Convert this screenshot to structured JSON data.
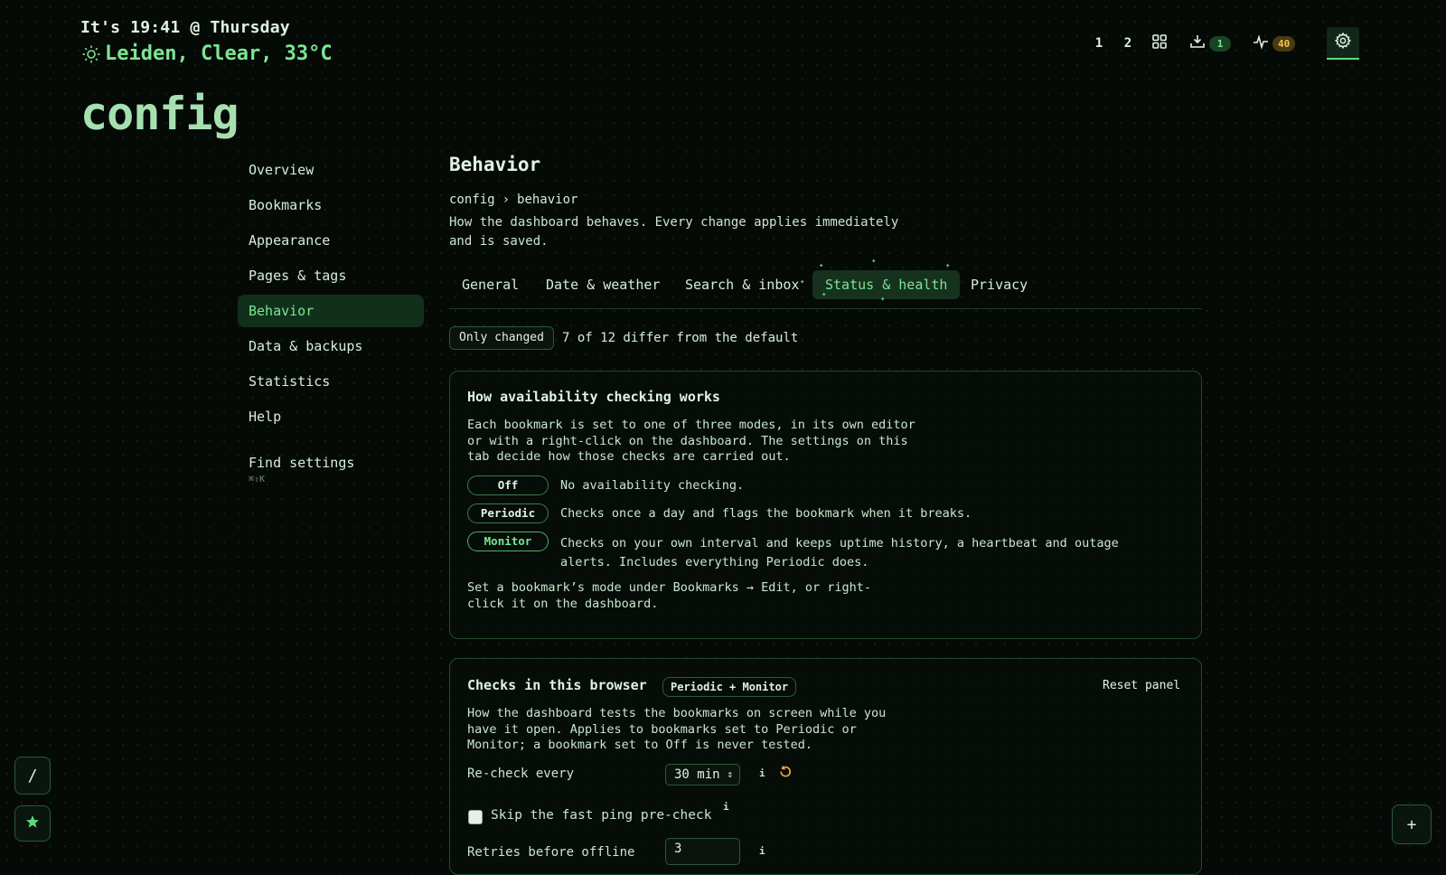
{
  "header": {
    "clock": "It's 19:41 @ Thursday",
    "weather_icon": "sun-icon",
    "weather": "Leiden, Clear, 33°C",
    "page_title": "config"
  },
  "topnav": {
    "page1": "1",
    "page2": "2",
    "grid_icon": "grid-icon",
    "inbox_icon": "inbox-tray-icon",
    "inbox_count": "1",
    "health_icon": "heartbeat-icon",
    "health_count": "40",
    "settings_icon": "gear-icon"
  },
  "sidebar": {
    "items": [
      {
        "label": "Overview"
      },
      {
        "label": "Bookmarks"
      },
      {
        "label": "Appearance"
      },
      {
        "label": "Pages & tags"
      },
      {
        "label": "Behavior",
        "active": true
      },
      {
        "label": "Data & backups"
      },
      {
        "label": "Statistics"
      },
      {
        "label": "Help"
      }
    ],
    "find_settings": "Find settings",
    "find_shortcut": "⌘⇧K"
  },
  "main": {
    "title": "Behavior",
    "breadcrumb": [
      "config",
      "›",
      "behavior"
    ],
    "description": "How the dashboard behaves. Every change applies immediately and is saved.",
    "tabs": [
      {
        "label": "General"
      },
      {
        "label": "Date & weather"
      },
      {
        "label": "Search & inbox"
      },
      {
        "label": "Status & health",
        "active": true
      },
      {
        "label": "Privacy"
      }
    ],
    "filter_chip": "Only changed",
    "filter_note": "7 of 12 differ from the default"
  },
  "card1": {
    "title": "How availability checking works",
    "intro": "Each bookmark is set to one of three modes, in its own editor or with a right-click on the dashboard. The settings on this tab decide how those checks are carried out.",
    "modes": [
      {
        "label": "Off",
        "text": "No availability checking."
      },
      {
        "label": "Periodic",
        "text": "Checks once a day and flags the bookmark when it breaks."
      },
      {
        "label": "Monitor",
        "text": "Checks on your own interval and keeps uptime history, a heartbeat and outage alerts. Includes everything Periodic does."
      }
    ],
    "footer": "Set a bookmark’s mode under Bookmarks → Edit, or right-click it on the dashboard."
  },
  "card2": {
    "title": "Checks in this browser",
    "tag": "Periodic + Monitor",
    "reset": "Reset panel",
    "intro": "How the dashboard tests the bookmarks on screen while you have it open. Applies to bookmarks set to Periodic or Monitor; a bookmark set to Off is never tested.",
    "recheck_label": "Re-check every",
    "recheck_value": "30 min",
    "info": "i",
    "reset_icon": "undo-icon",
    "skip_ping_label": "Skip the fast ping pre-check",
    "skip_ping_checked": false,
    "retries_label": "Retries before offline",
    "retries_value": "3"
  },
  "floating": {
    "slash": "/",
    "star_icon": "star-icon",
    "plus": "+"
  },
  "colors": {
    "accent": "#7be691",
    "background": "#060a07",
    "warning": "#f2c64d"
  }
}
